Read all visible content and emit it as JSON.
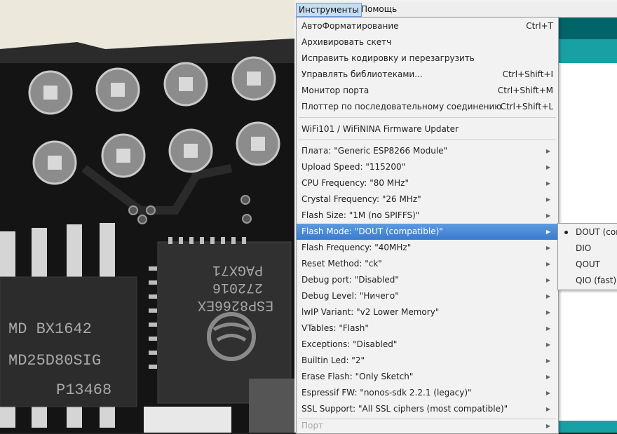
{
  "menubar": {
    "tools_label": "Инструменты",
    "help_label": "Помощь"
  },
  "tools_menu": {
    "items": [
      {
        "label": "АвтоФорматирование",
        "shortcut": "Ctrl+T"
      },
      {
        "label": "Архивировать скетч",
        "shortcut": ""
      },
      {
        "label": "Исправить кодировку и перезагрузить",
        "shortcut": ""
      },
      {
        "label": "Управлять библиотеками...",
        "shortcut": "Ctrl+Shift+I"
      },
      {
        "label": "Монитор порта",
        "shortcut": "Ctrl+Shift+M"
      },
      {
        "label": "Плоттер по последовательному соединению",
        "shortcut": "Ctrl+Shift+L"
      },
      {
        "label": "WiFi101 / WiFiNINA Firmware Updater",
        "shortcut": ""
      },
      {
        "label": "Плата: \"Generic ESP8266 Module\""
      },
      {
        "label": "Upload Speed: \"115200\""
      },
      {
        "label": "CPU Frequency: \"80 MHz\""
      },
      {
        "label": "Crystal Frequency: \"26 MHz\""
      },
      {
        "label": "Flash Size: \"1M (no SPIFFS)\""
      },
      {
        "label": "Flash Mode: \"DOUT (compatible)\""
      },
      {
        "label": "Flash Frequency: \"40MHz\""
      },
      {
        "label": "Reset Method: \"ck\""
      },
      {
        "label": "Debug port: \"Disabled\""
      },
      {
        "label": "Debug Level: \"Ничего\""
      },
      {
        "label": "lwIP Variant: \"v2 Lower Memory\""
      },
      {
        "label": "VTables: \"Flash\""
      },
      {
        "label": "Exceptions: \"Disabled\""
      },
      {
        "label": "Builtin Led: \"2\""
      },
      {
        "label": "Erase Flash: \"Only Sketch\""
      },
      {
        "label": "Espressif FW: \"nonos-sdk 2.2.1 (legacy)\""
      },
      {
        "label": "SSL Support: \"All SSL ciphers (most compatible)\""
      },
      {
        "label": "Порт"
      }
    ]
  },
  "flash_mode_submenu": {
    "items": [
      {
        "label": "DOUT (cor",
        "selected": true
      },
      {
        "label": "DIO",
        "selected": false
      },
      {
        "label": "QOUT",
        "selected": false
      },
      {
        "label": "QIO (fast)",
        "selected": false
      }
    ]
  },
  "photo": {
    "chip1_lines": [
      "MD BX1642",
      "MD25D80SIG",
      "P13468"
    ],
    "chip2_lines": [
      "ESP8266EX",
      "272016",
      "PAGX71"
    ]
  },
  "colors": {
    "highlight": "#3a7bd0",
    "app_teal": "#006468",
    "app_teal_light": "#17a1a5"
  }
}
